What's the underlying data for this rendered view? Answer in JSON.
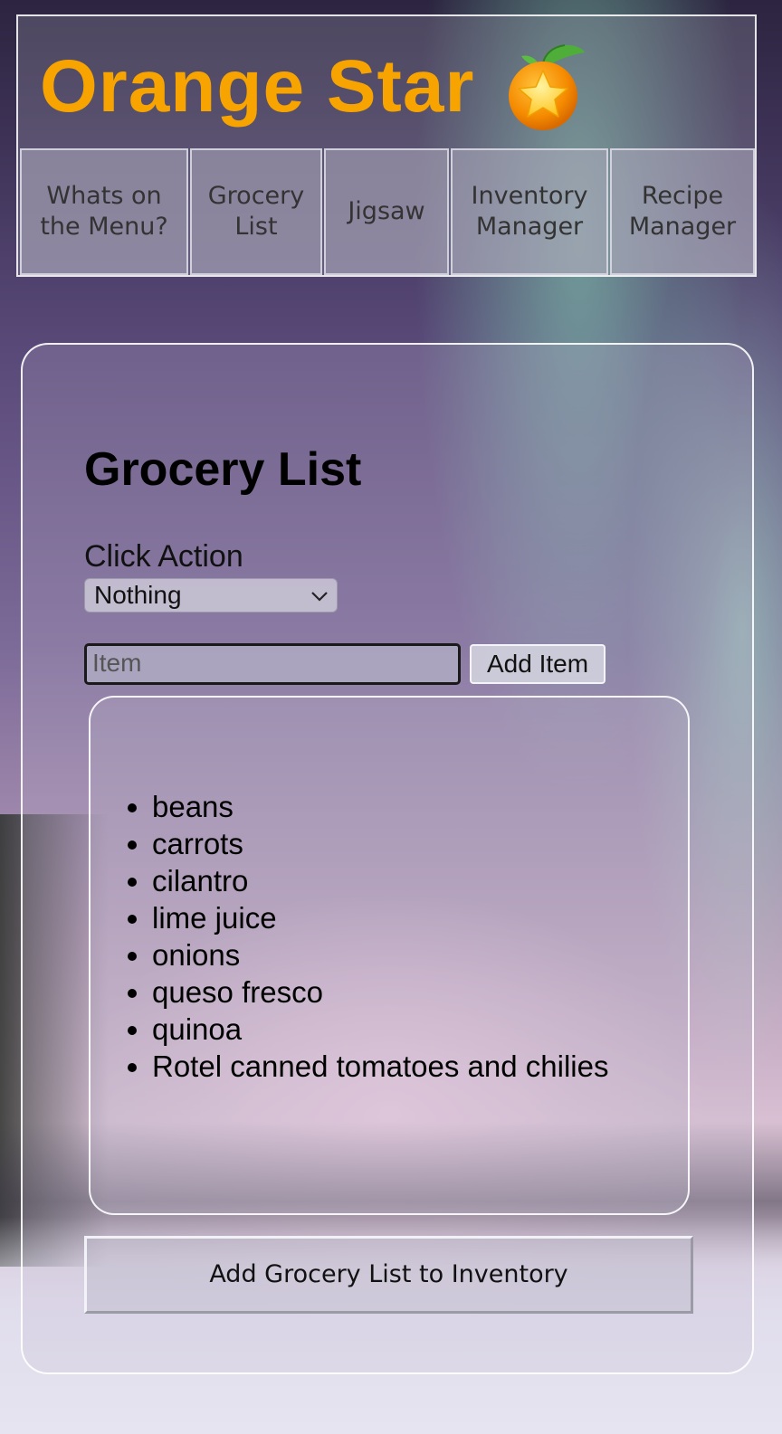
{
  "header": {
    "title": "Orange Star",
    "icon": "orange-star-icon",
    "title_color": "#f7a400"
  },
  "nav": {
    "items": [
      {
        "label": "Whats on the Menu?"
      },
      {
        "label": "Grocery List"
      },
      {
        "label": "Jigsaw"
      },
      {
        "label": "Inventory Manager"
      },
      {
        "label": "Recipe Manager"
      }
    ]
  },
  "main": {
    "heading": "Grocery List",
    "click_action_label": "Click Action",
    "click_action_value": "Nothing",
    "item_placeholder": "Item",
    "add_item_label": "Add Item",
    "grocery_items": [
      "beans",
      "carrots",
      "cilantro",
      "lime juice",
      "onions",
      "queso fresco",
      "quinoa",
      "Rotel canned tomatoes and chilies"
    ],
    "add_to_inventory_label": "Add Grocery List to Inventory"
  }
}
